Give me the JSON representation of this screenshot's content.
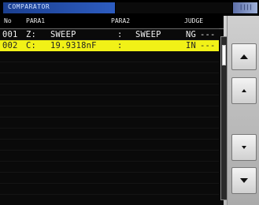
{
  "titlebar": {
    "title": "COMPARATOR",
    "right_label": "||||"
  },
  "table": {
    "headers": [
      "No",
      "PARA1",
      "PARA2",
      "JUDGE"
    ],
    "rows": [
      {
        "no": "001",
        "para1_label": "Z:",
        "para1_value": "SWEEP",
        "sep": ":",
        "para2_value": "SWEEP",
        "judge": "NG",
        "dash": "---",
        "selected": false
      },
      {
        "no": "002",
        "para1_label": "C:",
        "para1_value": "19.9318nF",
        "sep": ":",
        "para2_value": "",
        "judge": "IN",
        "dash": "---",
        "selected": true
      }
    ]
  },
  "side_buttons": [
    {
      "name": "page-up-button",
      "icon": "arrow-up-large"
    },
    {
      "name": "scroll-up-button",
      "icon": "arrow-up-small"
    },
    {
      "name": "scroll-down-button",
      "icon": "arrow-down-small"
    },
    {
      "name": "page-down-button",
      "icon": "arrow-down-large"
    }
  ]
}
